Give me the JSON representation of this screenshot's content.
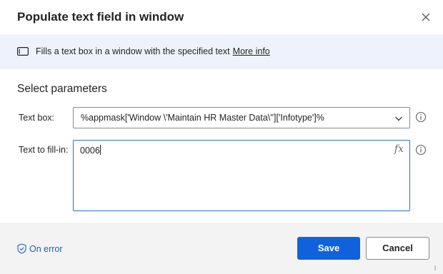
{
  "dialog": {
    "title": "Populate text field in window",
    "close_icon": "close-icon"
  },
  "banner": {
    "icon": "window-icon",
    "text": "Fills a text box in a window with the specified text",
    "link": "More info"
  },
  "parameters": {
    "section_title": "Select parameters",
    "text_box": {
      "label": "Text box:",
      "value": "%appmask['Window \\'Maintain HR Master Data\\'']['Infotype']%",
      "dropdown_icon": "chevron-down-icon",
      "info_icon": "info-icon"
    },
    "text_to_fill": {
      "label": "Text to fill-in:",
      "value": "0006",
      "fx": "fx",
      "info_icon": "info-icon"
    }
  },
  "footer": {
    "on_error": "On error",
    "save": "Save",
    "cancel": "Cancel"
  },
  "colors": {
    "accent": "#0f62dc",
    "banner_bg": "#eef3fb",
    "footer_bg": "#f3f3f3",
    "link": "#1f5fbf"
  }
}
